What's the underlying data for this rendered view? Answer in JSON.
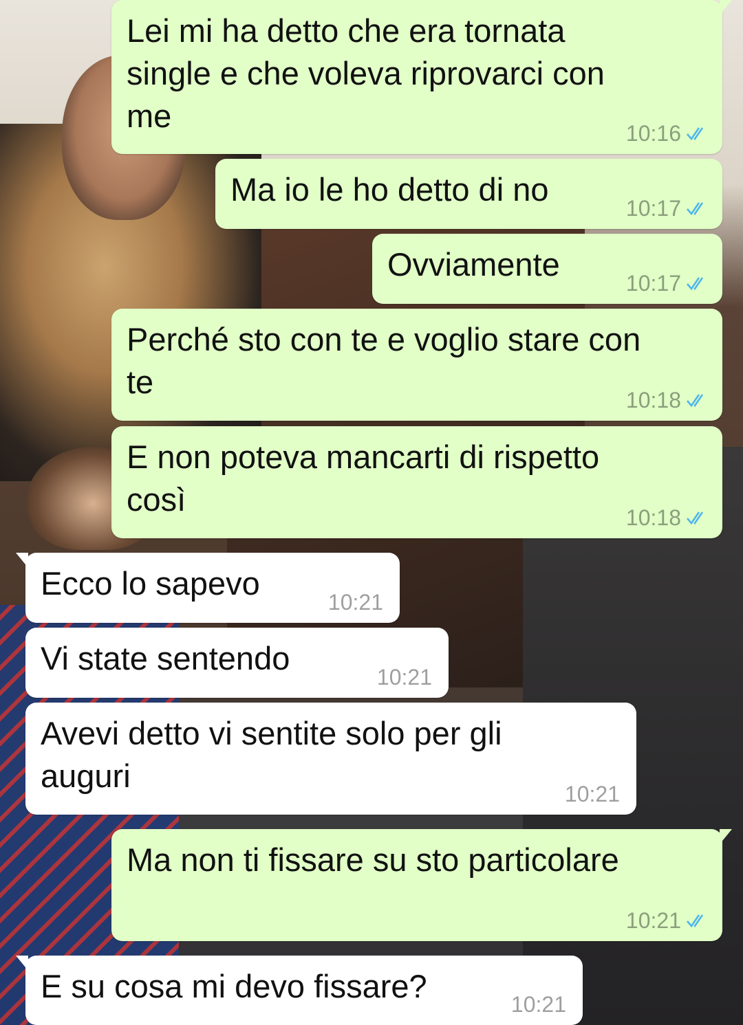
{
  "messages": [
    {
      "direction": "out",
      "text": "Lei mi ha detto che era tornata\nsingle e che voleva riprovarci con\nme",
      "time": "10:16",
      "status": "read"
    },
    {
      "direction": "out",
      "text": "Ma io le ho detto di no",
      "time": "10:17",
      "status": "read"
    },
    {
      "direction": "out",
      "text": "Ovviamente",
      "time": "10:17",
      "status": "read"
    },
    {
      "direction": "out",
      "text": "Perché sto con te e voglio stare con\nte",
      "time": "10:18",
      "status": "read"
    },
    {
      "direction": "out",
      "text": "E non poteva mancarti di rispetto\ncosì",
      "time": "10:18",
      "status": "read"
    },
    {
      "direction": "in",
      "text": "Ecco lo sapevo",
      "time": "10:21"
    },
    {
      "direction": "in",
      "text": "Vi state sentendo",
      "time": "10:21"
    },
    {
      "direction": "in",
      "text": "Avevi detto vi sentite solo per gli\nauguri",
      "time": "10:21"
    },
    {
      "direction": "out",
      "text": "Ma non ti fissare su sto particolare",
      "time": "10:21",
      "status": "read"
    },
    {
      "direction": "in",
      "text": "E su cosa mi devo fissare?",
      "time": "10:21"
    }
  ],
  "colors": {
    "outgoing_bubble": "#e1ffc7",
    "incoming_bubble": "#ffffff",
    "read_ticks": "#4fb6ec",
    "timestamp": "#8c8c8c"
  },
  "icons": {
    "read_status": "double-check-icon"
  }
}
